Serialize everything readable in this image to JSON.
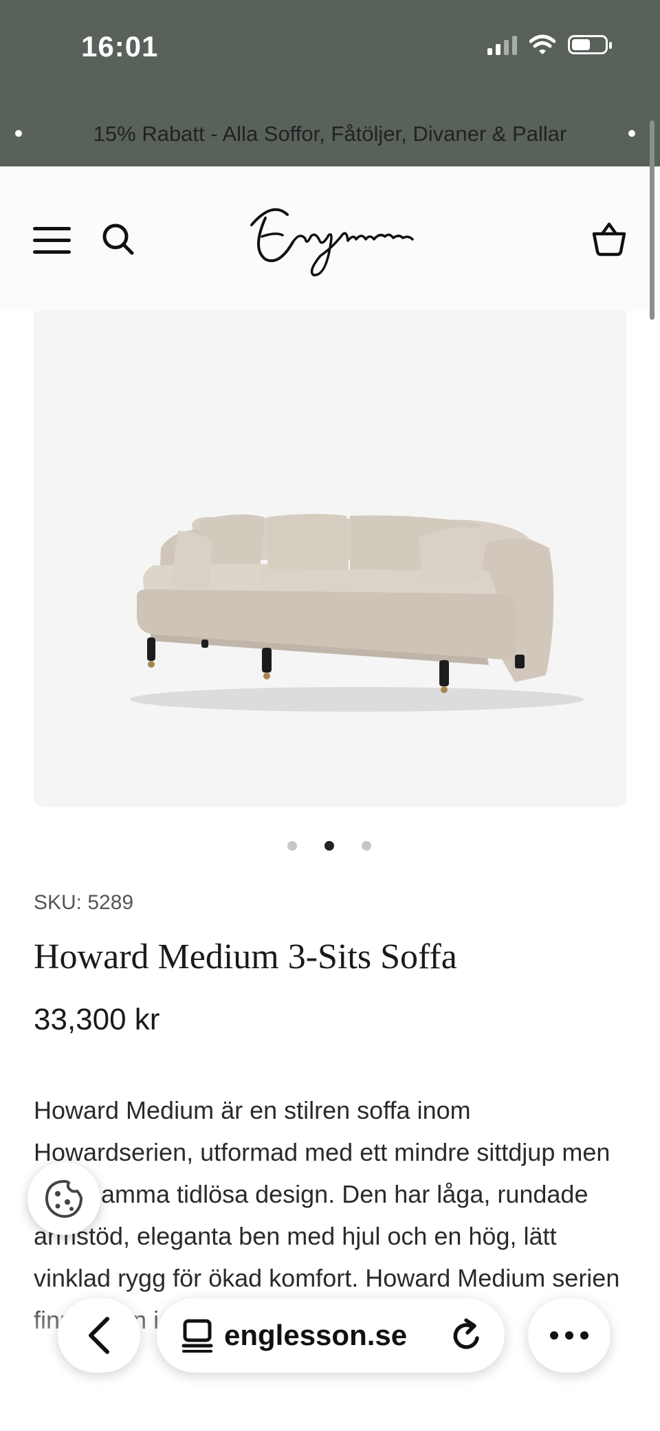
{
  "status_bar": {
    "time": "16:01"
  },
  "promo_banner": {
    "text": "15% Rabatt - Alla Soffor, Fåtöljer, Divaner & Pallar"
  },
  "header": {
    "brand": "Englesson"
  },
  "gallery": {
    "slides": 3,
    "active_slide": 2
  },
  "product": {
    "sku": "SKU: 5289",
    "title": "Howard Medium 3-Sits Soffa",
    "price": "33,300 kr",
    "description": "Howard Medium är en stilren soffa inom Howardserien, utformad med ett mindre sittdjup men med samma tidlösa design. Den har låga, rundade armstöd, eleganta ben med hjul och en hög, lätt vinklad rygg för ökad komfort. Howard Medium serien finns även i flera storlekar och Slim"
  },
  "browser": {
    "url": "englesson.se"
  },
  "colors": {
    "topbar": "#58615a",
    "background": "#ffffff",
    "text": "#222222"
  }
}
